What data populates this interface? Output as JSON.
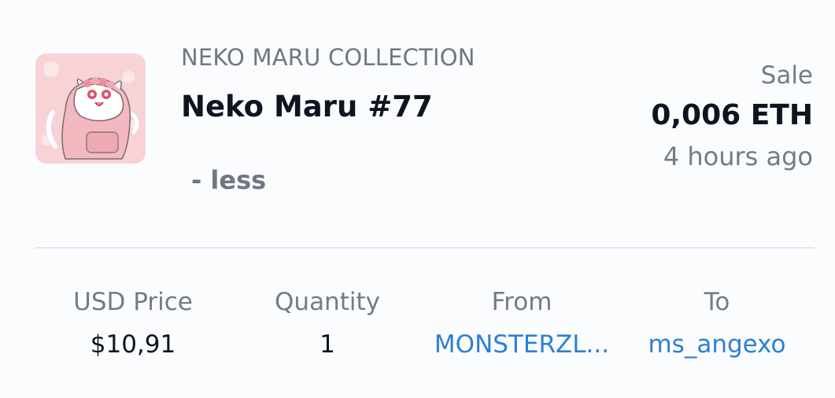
{
  "item": {
    "collection": "NEKO MARU COLLECTION",
    "name": "Neko Maru #77",
    "toggle_label": "- less"
  },
  "sale": {
    "event": "Sale",
    "price": "0,006 ETH",
    "time": "4 hours ago"
  },
  "details": {
    "usd_price": {
      "label": "USD Price",
      "value": "$10,91"
    },
    "quantity": {
      "label": "Quantity",
      "value": "1"
    },
    "from": {
      "label": "From",
      "value": "MONSTERZL..."
    },
    "to": {
      "label": "To",
      "value": "ms_angexo"
    }
  },
  "colors": {
    "link": "#2d7fd4",
    "text_primary": "#0d1520",
    "text_secondary": "#737b86",
    "thumbnail_bg": "#f6d0d3"
  }
}
